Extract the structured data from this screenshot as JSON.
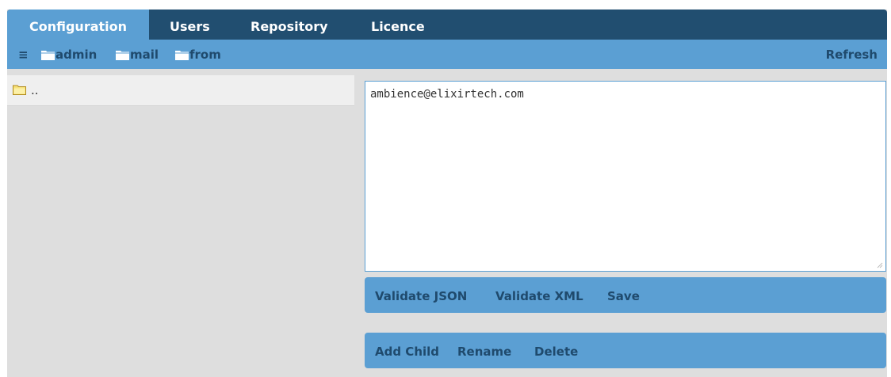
{
  "tabs": [
    {
      "label": "Configuration",
      "active": true
    },
    {
      "label": "Users",
      "active": false
    },
    {
      "label": "Repository",
      "active": false
    },
    {
      "label": "Licence",
      "active": false
    }
  ],
  "breadcrumb": {
    "menu_icon": "hamburger-icon",
    "items": [
      "admin",
      "mail",
      "from"
    ],
    "item_icon": "folder-icon"
  },
  "refresh_label": "Refresh",
  "file_list": [
    {
      "name": "..",
      "icon": "folder-open-icon"
    }
  ],
  "editor": {
    "value": "ambience@elixirtech.com"
  },
  "validate_bar": {
    "validate_json": "Validate JSON",
    "validate_xml": "Validate XML",
    "save": "Save"
  },
  "node_bar": {
    "add_child": "Add Child",
    "rename": "Rename",
    "delete": "Delete"
  },
  "colors": {
    "nav_dark": "#214e70",
    "nav_light": "#5b9fd3",
    "text_dark_blue": "#1f4a6d",
    "panel_gray": "#dedede"
  }
}
